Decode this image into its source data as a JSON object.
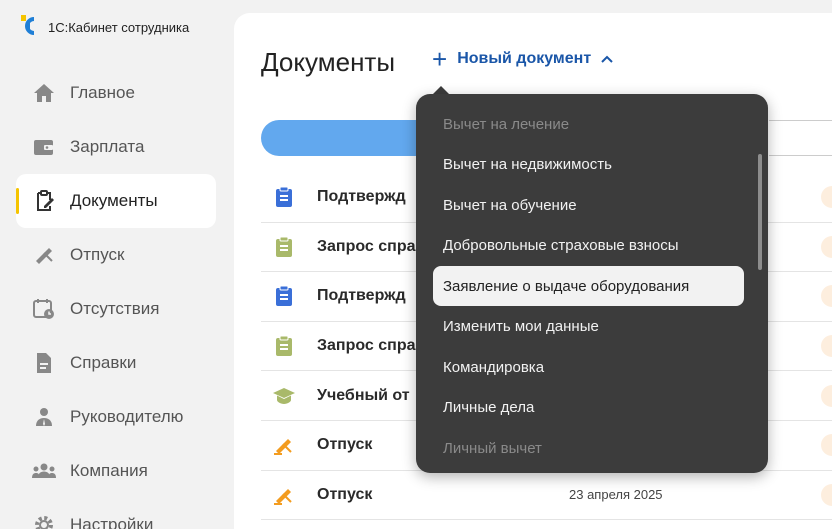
{
  "brand": {
    "name": "1С:Кабинет сотрудника"
  },
  "sidebar": {
    "items": [
      {
        "label": "Главное",
        "icon": "home-icon"
      },
      {
        "label": "Зарплата",
        "icon": "wallet-icon"
      },
      {
        "label": "Документы",
        "icon": "document-edit-icon",
        "active": true
      },
      {
        "label": "Отпуск",
        "icon": "vacation-icon"
      },
      {
        "label": "Отсутствия",
        "icon": "calendar-clock-icon"
      },
      {
        "label": "Справки",
        "icon": "certificate-icon"
      },
      {
        "label": "Руководителю",
        "icon": "manager-icon"
      },
      {
        "label": "Компания",
        "icon": "company-icon"
      },
      {
        "label": "Настройки",
        "icon": "gear-icon"
      }
    ]
  },
  "main": {
    "title": "Документы",
    "new_document_label": "Новый документ",
    "documents": [
      {
        "name": "Подтвержд",
        "icon": "clipboard-blue-icon",
        "date": ""
      },
      {
        "name": "Запрос спра",
        "icon": "clipboard-green-icon",
        "date": ""
      },
      {
        "name": "Подтвержд",
        "icon": "clipboard-blue-icon",
        "date": ""
      },
      {
        "name": "Запрос спра",
        "icon": "clipboard-green-icon",
        "date": ""
      },
      {
        "name": "Учебный от",
        "icon": "graduation-cap-icon",
        "date": ""
      },
      {
        "name": "Отпуск",
        "icon": "vacation-orange-icon",
        "date": ""
      },
      {
        "name": "Отпуск",
        "icon": "vacation-orange-icon",
        "date": "23 апреля 2025"
      }
    ]
  },
  "dropdown": {
    "items": [
      {
        "label": "Вычет на лечение",
        "faded": true
      },
      {
        "label": "Вычет на недвижимость"
      },
      {
        "label": "Вычет на обучение"
      },
      {
        "label": "Добровольные страховые взносы"
      },
      {
        "label": "Заявление о выдаче оборудования",
        "hover": true
      },
      {
        "label": "Изменить мои данные"
      },
      {
        "label": "Командировка"
      },
      {
        "label": "Личные дела"
      },
      {
        "label": "Личный вычет",
        "faded": true
      }
    ]
  },
  "colors": {
    "accent": "#1a56a8",
    "active_indicator": "#f5c400",
    "dropdown_bg": "#3c3c3c",
    "search_bar": "#62a8ee"
  }
}
